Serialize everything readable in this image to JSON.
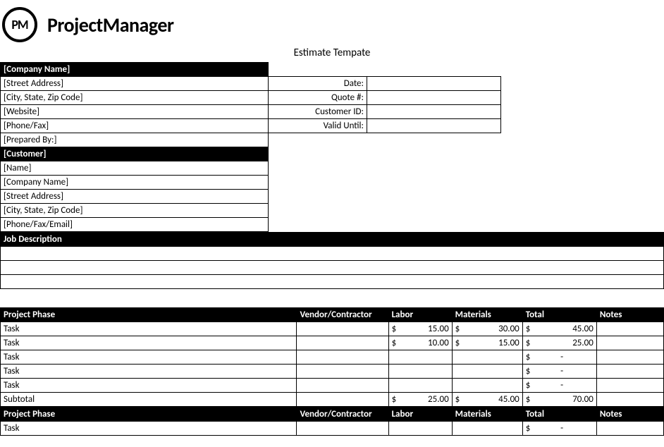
{
  "logo": {
    "badge": "PM",
    "name": "ProjectManager"
  },
  "title": "Estimate Tempate",
  "company_header": "[Company Name]",
  "company_rows": [
    "[Street Address]",
    "[City, State, Zip Code]",
    "[Website]",
    "[Phone/Fax]",
    "[Prepared By:]"
  ],
  "meta_labels": [
    "Date:",
    "Quote #:",
    "Customer ID:",
    "Valid Until:"
  ],
  "meta_values": [
    "",
    "",
    "",
    ""
  ],
  "customer_header": "[Customer]",
  "customer_rows": [
    "[Name]",
    "[Company Name]",
    "[Street Address]",
    "[City, State, Zip Code]",
    "[Phone/Fax/Email]"
  ],
  "job_desc_header": "Job Description",
  "phase_headers": [
    "Project Phase",
    "Vendor/Contractor",
    "Labor",
    "Materials",
    "Total",
    "Notes"
  ],
  "phase1": {
    "rows": [
      {
        "task": "Task",
        "vendor": "",
        "labor": "15.00",
        "materials": "30.00",
        "total": "45.00",
        "notes": ""
      },
      {
        "task": "Task",
        "vendor": "",
        "labor": "10.00",
        "materials": "15.00",
        "total": "25.00",
        "notes": ""
      },
      {
        "task": "Task",
        "vendor": "",
        "labor": "",
        "materials": "",
        "total": "-",
        "notes": ""
      },
      {
        "task": "Task",
        "vendor": "",
        "labor": "",
        "materials": "",
        "total": "-",
        "notes": ""
      },
      {
        "task": "Task",
        "vendor": "",
        "labor": "",
        "materials": "",
        "total": "-",
        "notes": ""
      }
    ],
    "subtotal": {
      "label": "Subtotal",
      "labor": "25.00",
      "materials": "45.00",
      "total": "70.00"
    }
  },
  "phase2": {
    "rows": [
      {
        "task": "Task",
        "vendor": "",
        "labor": "",
        "materials": "",
        "total": "-",
        "notes": ""
      }
    ]
  },
  "currency": "$"
}
